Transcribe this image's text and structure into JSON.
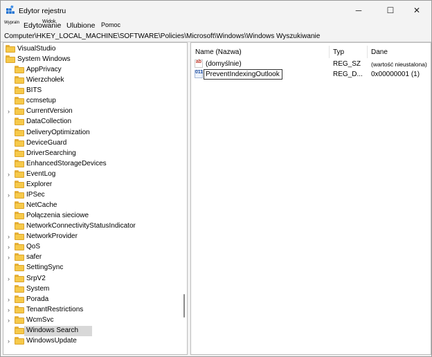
{
  "window": {
    "title": "Edytor rejestru",
    "controls": {
      "minimize": "─",
      "maximize": "☐",
      "close": "✕"
    }
  },
  "menu": {
    "file": "Wypraln",
    "edit": "Edytowanie",
    "view": "Widok",
    "favorites": "Ulubione",
    "help": "Pomoc"
  },
  "address": "Computer\\HKEY_LOCAL_MACHINE\\SOFTWARE\\Policies\\Microsoft\\Windows\\Windows Wyszukiwanie",
  "tree": {
    "items": [
      {
        "label": "VisualStudio",
        "level": 0,
        "expandable": false,
        "selected": false
      },
      {
        "label": "System Windows",
        "level": 0,
        "expandable": false,
        "selected": false
      },
      {
        "label": "AppPrivacy",
        "level": 1,
        "expandable": false,
        "selected": false
      },
      {
        "label": "Wierzchołek",
        "level": 1,
        "expandable": false,
        "selected": false
      },
      {
        "label": "BITS",
        "level": 1,
        "expandable": false,
        "selected": false
      },
      {
        "label": "ccmsetup",
        "level": 1,
        "expandable": false,
        "selected": false
      },
      {
        "label": "CurrentVersion",
        "level": 1,
        "expandable": true,
        "selected": false
      },
      {
        "label": "DataCollection",
        "level": 1,
        "expandable": false,
        "selected": false
      },
      {
        "label": "DeliveryOptimization",
        "level": 1,
        "expandable": false,
        "selected": false
      },
      {
        "label": "DeviceGuard",
        "level": 1,
        "expandable": false,
        "selected": false
      },
      {
        "label": "DriverSearching",
        "level": 1,
        "expandable": false,
        "selected": false
      },
      {
        "label": "EnhancedStorageDevices",
        "level": 1,
        "expandable": false,
        "selected": false
      },
      {
        "label": "EventLog",
        "level": 1,
        "expandable": true,
        "selected": false
      },
      {
        "label": "Explorer",
        "level": 1,
        "expandable": false,
        "selected": false
      },
      {
        "label": "IPSec",
        "level": 1,
        "expandable": true,
        "selected": false
      },
      {
        "label": "NetCache",
        "level": 1,
        "expandable": false,
        "selected": false
      },
      {
        "label": "Połączenia sieciowe",
        "level": 1,
        "expandable": false,
        "selected": false
      },
      {
        "label": "NetworkConnectivityStatusIndicator",
        "level": 1,
        "expandable": false,
        "selected": false
      },
      {
        "label": "NetworkProvider",
        "level": 1,
        "expandable": true,
        "selected": false
      },
      {
        "label": "QoS",
        "level": 1,
        "expandable": true,
        "selected": false
      },
      {
        "label": "safer",
        "level": 1,
        "expandable": true,
        "selected": false
      },
      {
        "label": "SettingSync",
        "level": 1,
        "expandable": false,
        "selected": false
      },
      {
        "label": "SrpV2",
        "level": 1,
        "expandable": true,
        "selected": false
      },
      {
        "label": "System",
        "level": 1,
        "expandable": false,
        "selected": false
      },
      {
        "label": "Porada",
        "level": 1,
        "expandable": true,
        "selected": false
      },
      {
        "label": "TenantRestrictions",
        "level": 1,
        "expandable": true,
        "selected": false
      },
      {
        "label": "WcmSvc",
        "level": 1,
        "expandable": true,
        "selected": false
      },
      {
        "label": "Windows Search",
        "level": 1,
        "expandable": false,
        "selected": true
      },
      {
        "label": "WindowsUpdate",
        "level": 1,
        "expandable": true,
        "selected": false
      }
    ]
  },
  "list": {
    "columns": {
      "name": "Name (Nazwa)",
      "type": "Typ",
      "data": "Dane"
    },
    "rows": [
      {
        "icon": "string-value-icon",
        "icon_text": "ab",
        "name": "(domyślnie)",
        "type": "REG_SZ",
        "data": "(wartość nieustalona)",
        "editing": false
      },
      {
        "icon": "binary-value-icon",
        "icon_text": "011",
        "name": "PreventIndexingOutlook",
        "type": "REG_D...",
        "data": "0x00000001 (1)",
        "editing": true
      }
    ]
  },
  "colors": {
    "folder": "#f6c94a",
    "folder_border": "#dba42c",
    "selection": "#d8d8d8",
    "app_icon": "#1a6fd1"
  }
}
